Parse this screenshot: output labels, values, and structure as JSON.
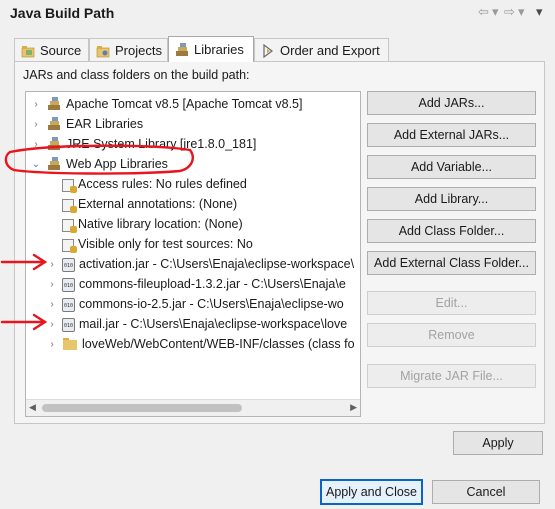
{
  "header": {
    "title": "Java Build Path",
    "nav_back": "⇦",
    "nav_fwd": "⇨",
    "menu": "▾"
  },
  "tabs": [
    {
      "label": "Source",
      "icon": "source-folder-icon",
      "active": false
    },
    {
      "label": "Projects",
      "icon": "projects-icon",
      "active": false
    },
    {
      "label": "Libraries",
      "icon": "libraries-icon",
      "active": true
    },
    {
      "label": "Order and Export",
      "icon": "order-export-icon",
      "active": false
    }
  ],
  "panel": {
    "label": "JARs and class folders on the build path:"
  },
  "tree": {
    "items": [
      {
        "label": "Apache Tomcat v8.5 [Apache Tomcat v8.5]",
        "icon": "library-icon",
        "expander": "›"
      },
      {
        "label": "EAR Libraries",
        "icon": "library-icon",
        "expander": "›"
      },
      {
        "label": "JRE System Library [jre1.8.0_181]",
        "icon": "library-icon",
        "expander": "›"
      },
      {
        "label": "Web App Libraries",
        "icon": "library-icon",
        "expander": "⌄"
      },
      {
        "label": "Access rules: No rules defined",
        "icon": "access-rules-icon"
      },
      {
        "label": "External annotations: (None)",
        "icon": "annotations-icon"
      },
      {
        "label": "Native library location: (None)",
        "icon": "native-library-icon"
      },
      {
        "label": "Visible only for test sources: No",
        "icon": "test-sources-icon"
      },
      {
        "label": "activation.jar - C:\\Users\\Enaja\\eclipse-workspace\\",
        "icon": "jar-icon",
        "expander": "›"
      },
      {
        "label": "commons-fileupload-1.3.2.jar - C:\\Users\\Enaja\\e",
        "icon": "jar-icon",
        "expander": "›"
      },
      {
        "label": "commons-io-2.5.jar - C:\\Users\\Enaja\\eclipse-wo",
        "icon": "jar-icon",
        "expander": "›"
      },
      {
        "label": "mail.jar - C:\\Users\\Enaja\\eclipse-workspace\\love",
        "icon": "jar-icon",
        "expander": "›"
      },
      {
        "label": "loveWeb/WebContent/WEB-INF/classes (class fo",
        "icon": "class-folder-icon",
        "expander": "›"
      }
    ],
    "scroll_left": "◀",
    "scroll_right": "▶"
  },
  "buttons": {
    "add_jars": "Add JARs...",
    "add_external_jars": "Add External JARs...",
    "add_variable": "Add Variable...",
    "add_library": "Add Library...",
    "add_class_folder": "Add Class Folder...",
    "add_external_class_folder": "Add External Class Folder...",
    "edit": "Edit...",
    "remove": "Remove",
    "migrate_jar": "Migrate JAR File...",
    "apply": "Apply",
    "apply_and_close": "Apply and Close",
    "cancel": "Cancel"
  },
  "colors": {
    "annotation_red": "#e8141e",
    "focus_blue": "#0a64c8"
  }
}
